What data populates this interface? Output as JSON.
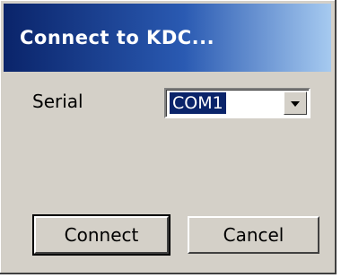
{
  "dialog": {
    "title": "Connect to KDC..."
  },
  "serial": {
    "label": "Serial",
    "selected": "COM1"
  },
  "buttons": {
    "connect": "Connect",
    "cancel": "Cancel"
  },
  "colors": {
    "face": "#d4d0c8",
    "title_start": "#0a246a",
    "title_end": "#a6caf0",
    "highlight": "#0a246a"
  },
  "icons": {
    "dropdown": "chevron-down-icon"
  }
}
